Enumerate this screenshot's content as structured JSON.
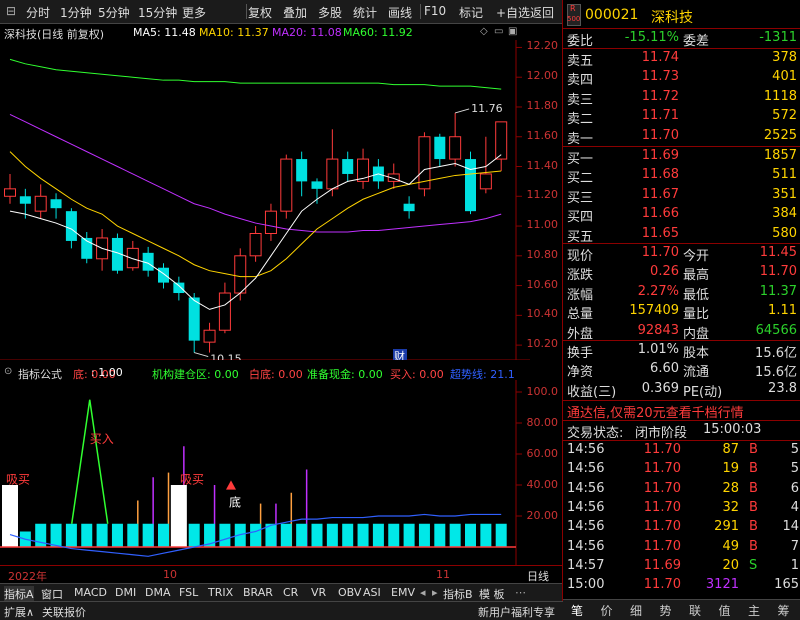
{
  "toolbar": {
    "items": [
      "分时",
      "1分钟",
      "5分钟",
      "15分钟",
      "更多",
      "复权",
      "叠加",
      "多股",
      "统计",
      "画线",
      "F10",
      "标记",
      "+自选",
      "返回"
    ]
  },
  "chart_header": {
    "title": "深科技(日线 前复权)",
    "ma5": "MA5: 11.48",
    "ma10": "MA10: 11.37",
    "ma20": "MA20: 11.08",
    "ma60": "MA60: 11.92"
  },
  "main_axis": {
    "labels": [
      "12.20",
      "12.00",
      "11.80",
      "11.60",
      "11.40",
      "11.20",
      "11.00",
      "10.80",
      "10.60",
      "10.40",
      "10.20"
    ]
  },
  "annotations": {
    "high": "11.76",
    "low": "10.15",
    "cai_marker": "财"
  },
  "indicator": {
    "name": "指标公式",
    "params": [
      {
        "label": "底: 0.00",
        "color": "#ff4444"
      },
      {
        "label": ": 1.00",
        "color": "#ffffff"
      },
      {
        "label": "机构建仓区: 0.00",
        "color": "#30ff30"
      },
      {
        "label": "白底: 0.00",
        "color": "#ff4444"
      },
      {
        "label": "准备现金: 0.00",
        "color": "#30ff30"
      },
      {
        "label": "买入: 0.00",
        "color": "#ff4444"
      },
      {
        "label": "超势线: 21.1",
        "color": "#3060ff"
      }
    ],
    "axis": [
      "100.0",
      "80.00",
      "60.00",
      "40.00",
      "20.00"
    ],
    "signals": {
      "buy": "买入",
      "suoma1": "吸买",
      "suoma2": "吸买",
      "di": "底"
    }
  },
  "xaxis": {
    "y2022": "2022年",
    "m10": "10",
    "m11": "11",
    "daily": "日线"
  },
  "tabs": [
    "指标A",
    "窗口",
    "MACD",
    "DMI",
    "DMA",
    "FSL",
    "TRIX",
    "BRAR",
    "CR",
    "VR",
    "OBV",
    "ASI",
    "EMV",
    "指标B",
    "模 板"
  ],
  "footer": {
    "expand": "扩展∧",
    "compare": "关联报价",
    "news": "新用户福利专享",
    "right_tabs": [
      "笔",
      "价",
      "细",
      "势",
      "联",
      "值",
      "主",
      "筹"
    ]
  },
  "stock": {
    "badge_r": "R",
    "badge_num": "500",
    "code": "000021",
    "name": "深科技"
  },
  "order_ratio": {
    "label1": "委比",
    "val1": "-15.11%",
    "label2": "委差",
    "val2": "-1311"
  },
  "asks": [
    {
      "label": "卖五",
      "price": "11.74",
      "vol": "378"
    },
    {
      "label": "卖四",
      "price": "11.73",
      "vol": "401"
    },
    {
      "label": "卖三",
      "price": "11.72",
      "vol": "1118"
    },
    {
      "label": "卖二",
      "price": "11.71",
      "vol": "572"
    },
    {
      "label": "卖一",
      "price": "11.70",
      "vol": "2525"
    }
  ],
  "bids": [
    {
      "label": "买一",
      "price": "11.69",
      "vol": "1857"
    },
    {
      "label": "买二",
      "price": "11.68",
      "vol": "511"
    },
    {
      "label": "买三",
      "price": "11.67",
      "vol": "351"
    },
    {
      "label": "买四",
      "price": "11.66",
      "vol": "384"
    },
    {
      "label": "买五",
      "price": "11.65",
      "vol": "580"
    }
  ],
  "quote": [
    {
      "l1": "现价",
      "v1": "11.70",
      "l2": "今开",
      "v2": "11.45"
    },
    {
      "l1": "涨跌",
      "v1": "0.26",
      "l2": "最高",
      "v2": "11.70"
    },
    {
      "l1": "涨幅",
      "v1": "2.27%",
      "l2": "最低",
      "v2": "11.37"
    },
    {
      "l1": "总量",
      "v1": "157409",
      "l2": "量比",
      "v2": "1.11"
    },
    {
      "l1": "外盘",
      "v1": "92843",
      "l2": "内盘",
      "v2": "64566"
    }
  ],
  "stats": [
    {
      "l1": "换手",
      "v1": "1.01%",
      "l2": "股本",
      "v2": "15.6亿"
    },
    {
      "l1": "净资",
      "v1": "6.60",
      "l2": "流通",
      "v2": "15.6亿"
    },
    {
      "l1": "收益(三)",
      "v1": "0.369",
      "l2": "PE(动)",
      "v2": "23.8"
    }
  ],
  "promo": "通达信,仅需20元查看千档行情",
  "trade_status": {
    "label": "交易状态:",
    "status": "闭市阶段",
    "time": "15:00:03"
  },
  "ticks": [
    {
      "t": "14:56",
      "p": "11.70",
      "v": "87",
      "s": "B",
      "n": "5"
    },
    {
      "t": "14:56",
      "p": "11.70",
      "v": "19",
      "s": "B",
      "n": "5"
    },
    {
      "t": "14:56",
      "p": "11.70",
      "v": "28",
      "s": "B",
      "n": "6"
    },
    {
      "t": "14:56",
      "p": "11.70",
      "v": "32",
      "s": "B",
      "n": "4"
    },
    {
      "t": "14:56",
      "p": "11.70",
      "v": "291",
      "s": "B",
      "n": "14"
    },
    {
      "t": "14:56",
      "p": "11.70",
      "v": "49",
      "s": "B",
      "n": "7"
    },
    {
      "t": "14:57",
      "p": "11.69",
      "v": "20",
      "s": "S",
      "n": "1"
    },
    {
      "t": "15:00",
      "p": "11.70",
      "v": "3121",
      "s": "",
      "n": "165"
    }
  ],
  "colors": {
    "up": "#ff3b3b",
    "down": "#00e0e0",
    "ma5": "#ffffff",
    "ma10": "#ffd400",
    "ma20": "#c030ff",
    "ma60": "#30ff30",
    "axis": "#8b0000"
  },
  "chart_data": {
    "type": "candlestick",
    "ylim": [
      10.1,
      12.25
    ],
    "candles": [
      [
        11.2,
        11.25,
        11.35,
        11.15
      ],
      [
        11.2,
        11.15,
        11.25,
        11.05
      ],
      [
        11.1,
        11.2,
        11.28,
        11.05
      ],
      [
        11.18,
        11.12,
        11.22,
        11.05
      ],
      [
        11.1,
        10.9,
        11.12,
        10.85
      ],
      [
        10.92,
        10.78,
        10.96,
        10.75
      ],
      [
        10.78,
        10.92,
        10.98,
        10.7
      ],
      [
        10.92,
        10.7,
        10.95,
        10.68
      ],
      [
        10.72,
        10.85,
        10.9,
        10.7
      ],
      [
        10.82,
        10.7,
        10.86,
        10.66
      ],
      [
        10.72,
        10.62,
        10.75,
        10.58
      ],
      [
        10.62,
        10.55,
        10.66,
        10.5
      ],
      [
        10.52,
        10.23,
        10.55,
        10.15
      ],
      [
        10.22,
        10.3,
        10.35,
        10.15
      ],
      [
        10.3,
        10.55,
        10.62,
        10.28
      ],
      [
        10.55,
        10.8,
        10.85,
        10.5
      ],
      [
        10.8,
        10.95,
        11.0,
        10.76
      ],
      [
        10.95,
        11.1,
        11.15,
        10.9
      ],
      [
        11.1,
        11.45,
        11.48,
        11.05
      ],
      [
        11.45,
        11.3,
        11.5,
        11.2
      ],
      [
        11.3,
        11.25,
        11.32,
        11.15
      ],
      [
        11.25,
        11.45,
        11.65,
        11.2
      ],
      [
        11.45,
        11.35,
        11.5,
        11.3
      ],
      [
        11.3,
        11.45,
        11.52,
        11.25
      ],
      [
        11.4,
        11.3,
        11.45,
        11.25
      ],
      [
        11.3,
        11.35,
        11.42,
        11.25
      ],
      [
        11.15,
        11.1,
        11.2,
        11.05
      ],
      [
        11.25,
        11.6,
        11.63,
        11.2
      ],
      [
        11.6,
        11.45,
        11.62,
        11.4
      ],
      [
        11.45,
        11.6,
        11.76,
        11.4
      ],
      [
        11.45,
        11.1,
        11.5,
        11.08
      ],
      [
        11.25,
        11.35,
        11.6,
        11.22
      ],
      [
        11.45,
        11.7,
        11.7,
        11.37
      ]
    ],
    "ma5": [
      11.1,
      11.08,
      11.05,
      11.02,
      10.98,
      10.9,
      10.85,
      10.82,
      10.78,
      10.75,
      10.68,
      10.6,
      10.5,
      10.44,
      10.47,
      10.55,
      10.65,
      10.8,
      10.95,
      11.1,
      11.18,
      11.25,
      11.3,
      11.32,
      11.35,
      11.32,
      11.28,
      11.38,
      11.4,
      11.42,
      11.38,
      11.4,
      11.48
    ],
    "ma10": [
      11.5,
      11.4,
      11.32,
      11.25,
      11.18,
      11.12,
      11.08,
      11.0,
      10.95,
      10.9,
      10.85,
      10.8,
      10.74,
      10.7,
      10.68,
      10.66,
      10.66,
      10.7,
      10.78,
      10.88,
      10.98,
      11.05,
      11.12,
      11.18,
      11.22,
      11.26,
      11.28,
      11.3,
      11.32,
      11.34,
      11.35,
      11.36,
      11.37
    ],
    "ma20": [
      11.75,
      11.7,
      11.65,
      11.6,
      11.55,
      11.5,
      11.45,
      11.4,
      11.35,
      11.3,
      11.25,
      11.2,
      11.15,
      11.12,
      11.08,
      11.05,
      11.02,
      11.0,
      10.98,
      10.97,
      10.96,
      10.96,
      10.96,
      10.97,
      10.97,
      10.98,
      10.99,
      11.0,
      11.01,
      11.02,
      11.03,
      11.05,
      11.08
    ],
    "ma60": [
      12.12,
      12.09,
      12.07,
      12.05,
      12.04,
      12.03,
      12.02,
      12.01,
      12.0,
      11.99,
      11.98,
      11.98,
      11.97,
      11.97,
      11.97,
      11.96,
      11.96,
      11.96,
      11.96,
      11.96,
      11.96,
      11.96,
      11.96,
      11.96,
      11.96,
      11.95,
      11.95,
      11.95,
      11.94,
      11.94,
      11.94,
      11.93,
      11.92
    ],
    "ind_bars": [
      50,
      10,
      15,
      15,
      15,
      15,
      15,
      15,
      15,
      15,
      15,
      15,
      15,
      15,
      15,
      15,
      15,
      15,
      15,
      15,
      15,
      15,
      15,
      15,
      15,
      15,
      15,
      15,
      15,
      15,
      15,
      15,
      15
    ],
    "ind_white": [
      1,
      0,
      0,
      0,
      0,
      0,
      0,
      0,
      0,
      0,
      0,
      1,
      0,
      0,
      0,
      0,
      0,
      0,
      0,
      0,
      0,
      0,
      0,
      0,
      0,
      0,
      0,
      0,
      0,
      0,
      0,
      0,
      0
    ],
    "ind_spikes": [
      0,
      0,
      0,
      0,
      0,
      0,
      0,
      0,
      30,
      45,
      48,
      65,
      0,
      40,
      0,
      0,
      28,
      28,
      35,
      50,
      0,
      0,
      0,
      0,
      0,
      0,
      0,
      0,
      0,
      0,
      0,
      0,
      0
    ],
    "ind_blue": [
      8,
      5,
      3,
      1,
      -1,
      -2,
      -3,
      -4,
      -5,
      -6,
      -4,
      -2,
      0,
      2,
      5,
      8,
      10,
      14,
      16,
      18,
      18,
      19,
      19,
      19,
      20,
      20,
      20,
      21,
      20,
      20,
      21,
      21,
      21
    ],
    "ind_buy_peak": [
      5,
      95
    ]
  }
}
